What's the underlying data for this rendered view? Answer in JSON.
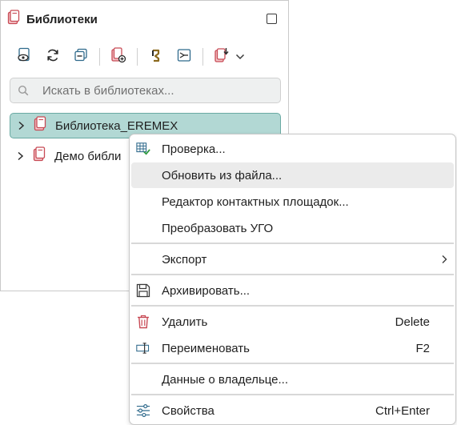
{
  "panel": {
    "title": "Библиотеки",
    "search": {
      "placeholder": "Искать в библиотеках...",
      "value": ""
    },
    "tree": [
      {
        "label": "Библиотека_EREMEX",
        "selected": true
      },
      {
        "label": "Демо библи",
        "selected": false
      }
    ]
  },
  "menu": {
    "items": {
      "check": "Проверка...",
      "update_from_file": "Обновить из файла...",
      "pad_editor": "Редактор контактных площадок...",
      "convert_ugo": "Преобразовать УГО",
      "export": "Экспорт",
      "archive": "Архивировать...",
      "delete": "Удалить",
      "delete_shortcut": "Delete",
      "rename": "Переименовать",
      "rename_shortcut": "F2",
      "owner_data": "Данные о владельце...",
      "properties": "Свойства",
      "properties_shortcut": "Ctrl+Enter"
    }
  },
  "colors": {
    "selection": "#b2d8d4",
    "book_red": "#c84a55",
    "accent_teal": "#2f8f86",
    "hover": "#ebebeb"
  }
}
